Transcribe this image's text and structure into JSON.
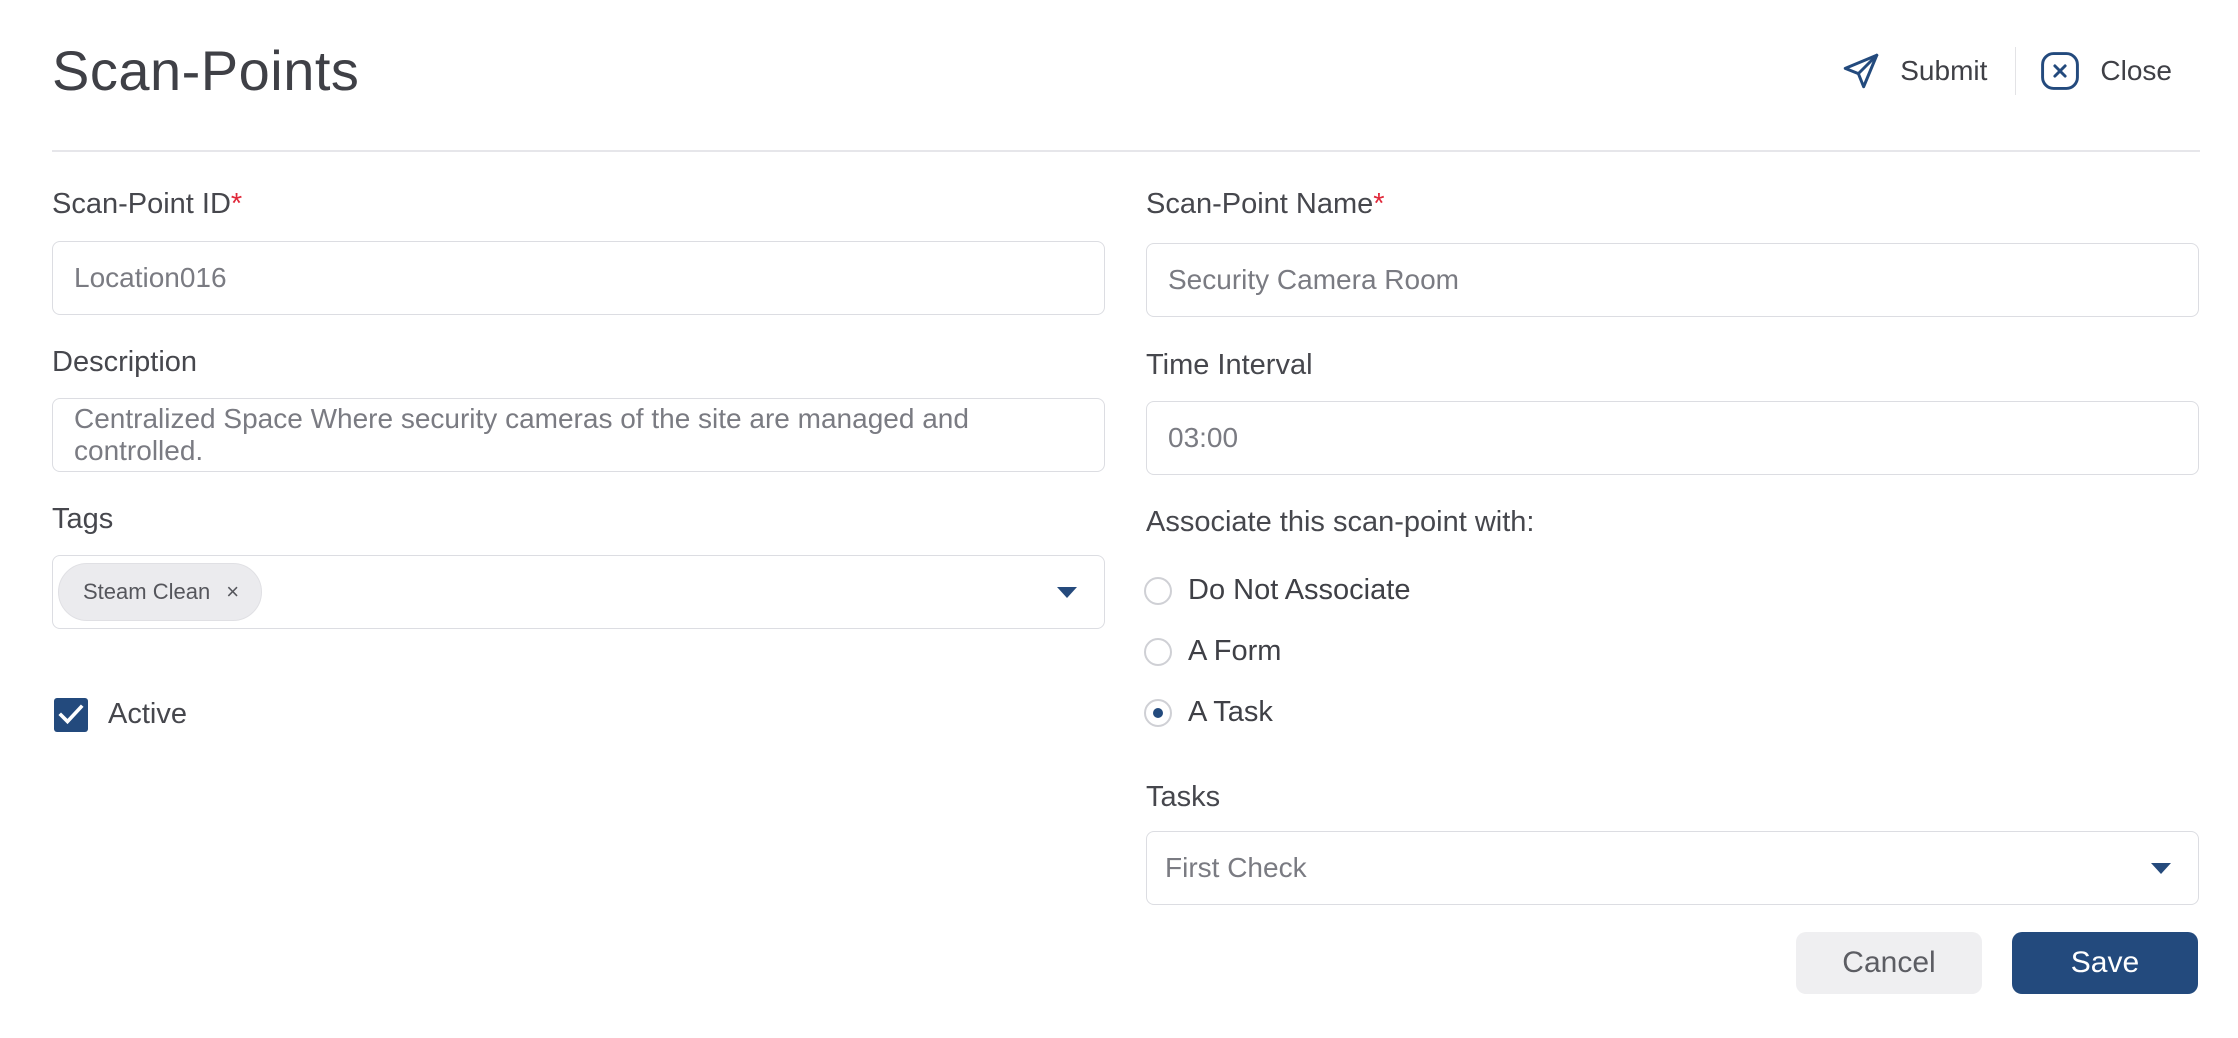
{
  "header": {
    "title": "Scan-Points",
    "submit_label": "Submit",
    "close_label": "Close",
    "submit_icon": "send-icon",
    "close_icon": "close-icon"
  },
  "form": {
    "scan_point_id": {
      "label": "Scan-Point ID",
      "required_mark": "*",
      "value": "Location016"
    },
    "scan_point_name": {
      "label": "Scan-Point Name",
      "required_mark": "*",
      "value": "Security Camera Room"
    },
    "description": {
      "label": "Description",
      "value": "Centralized Space Where security cameras of the site are managed and controlled."
    },
    "time_interval": {
      "label": "Time Interval",
      "value": "03:00"
    },
    "tags": {
      "label": "Tags",
      "chips": [
        "Steam Clean"
      ],
      "remove_glyph": "×"
    },
    "active": {
      "label": "Active",
      "checked": true
    },
    "associate": {
      "label": "Associate this scan-point with:",
      "options": [
        {
          "label": "Do Not Associate",
          "selected": false
        },
        {
          "label": "A Form",
          "selected": false
        },
        {
          "label": "A Task",
          "selected": true
        }
      ]
    },
    "tasks": {
      "label": "Tasks",
      "value": "First Check"
    }
  },
  "footer": {
    "cancel_label": "Cancel",
    "save_label": "Save"
  },
  "colors": {
    "primary": "#234a7d",
    "required": "#e0283a",
    "text": "#3f4046"
  }
}
